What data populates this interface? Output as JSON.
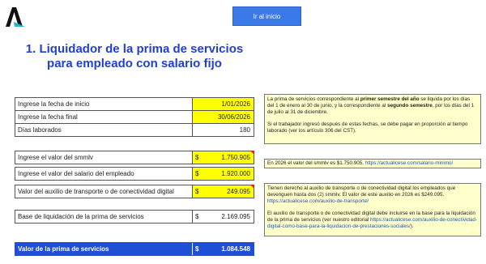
{
  "button": {
    "label": "Ir al inicio"
  },
  "title": {
    "line1": "1. Liquidador de la prima de servicios",
    "line2": "para empleado con salario fijo"
  },
  "rows": [
    {
      "label": "Ingrese la fecha de inicio",
      "value": "1/01/2026"
    },
    {
      "label": "Ingrese la fecha final",
      "value": "30/06/2026"
    },
    {
      "label": "Días laborados",
      "value": "180"
    },
    {
      "label": "Ingrese el valor del smmlv",
      "currency": "$",
      "value": "1.750.905"
    },
    {
      "label": "Ingrese el valor del salario del empleado",
      "currency": "$",
      "value": "1.920.000"
    },
    {
      "label": "Valor del auxilio de transporte o de conectividad digital",
      "currency": "$",
      "value": "249.095"
    },
    {
      "label": "Base de liquidación de la prima de servicios",
      "currency": "$",
      "value": "2.169.095"
    },
    {
      "label": "Valor de la prima de servicios",
      "currency": "$",
      "value": "1.084.548"
    }
  ],
  "notes": {
    "n1": {
      "p1a": "La prima de servicios correspondiente al ",
      "p1b": "primer semestre del año",
      "p1c": " se liquida por los días del 1 de enero al 30 de junio, y la correspondiente al ",
      "p1d": "segundo semestre",
      "p1e": ", por los días del 1 de julio al 31 de diciembre.",
      "p2": "Si el trabajador ingresó después de estas fechas, se debe pagar en proporción al tiempo laborado (ver los artículo 306 del CST)."
    },
    "n2": {
      "text": "En 2026 el valor del smmlv es $1.750.905. ",
      "link": "https://actualicese.com/salario-minimo/"
    },
    "n3": {
      "p1": "Tienen derecho al auxilio de transporte o de conectividad digital los empleados que devenguen hasta dos (2) smmlv. El valor de este auxilio en 2026 es $249.095.",
      "link1": "https://actualicese.com/auxilio-de-transporte/",
      "p2": "El auxilio de transporte o de conectividad digital debe incluirse en la base para la liquidación de la prima de servicios (ver nuestro editorial ",
      "link2": "https://actualicese.com/auxilio-de-conectividad-digital-como-base-para-la-liquidacion-de-prestaciones-sociales/",
      "p2end": ")."
    }
  }
}
